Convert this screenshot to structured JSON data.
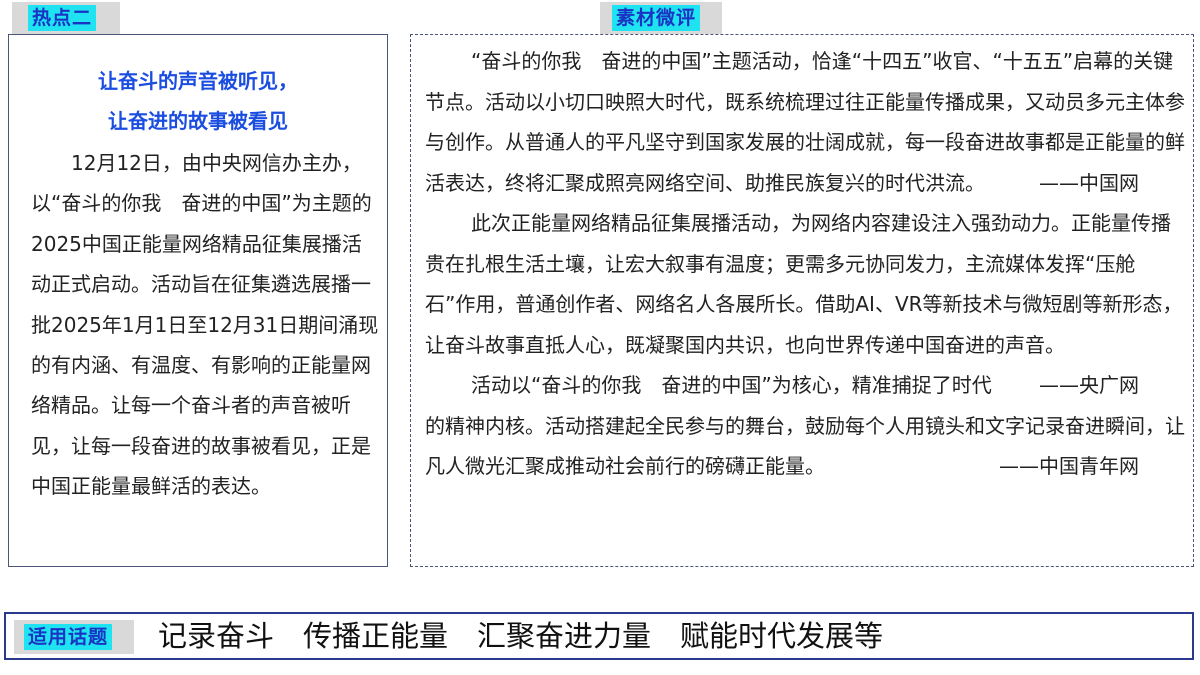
{
  "left": {
    "tag": "热点二",
    "title_line1": "让奋斗的声音被听见，",
    "title_line2": "让奋进的故事被看见",
    "body": "12月12日，由中央网信办主办，以“奋斗的你我　奋进的中国”为主题的2025中国正能量网络精品征集展播活动正式启动。活动旨在征集遴选展播一批2025年1月1日至12月31日期间涌现的有内涵、有温度、有影响的正能量网络精品。让每一个奋斗者的声音被听见，让每一段奋进的故事被看见，正是中国正能量最鲜活的表达。"
  },
  "right": {
    "tag": "素材微评",
    "comments": [
      {
        "text": "“奋斗的你我　奋进的中国”主题活动，恰逢“十四五”收官、“十五五”启幕的关键节点。活动以小切口映照大时代，既系统梳理过往正能量传播成果，又动员多元主体参与创作。从普通人的平凡坚守到国家发展的壮阔成就，每一段奋进故事都是正能量的鲜活表达，终将汇聚成照亮网络空间、助推民族复兴的时代洪流。",
        "source": "——中国网"
      },
      {
        "text": "此次正能量网络精品征集展播活动，为网络内容建设注入强劲动力。正能量传播贵在扎根生活土壤，让宏大叙事有温度；更需多元协同发力，主流媒体发挥“压舱石”作用，普通创作者、网络名人各展所长。借助AI、VR等新技术与微短剧等新形态，让奋斗故事直抵人心，既凝聚国内共识，也向世界传递中国奋进的声音。",
        "source": "——央广网"
      },
      {
        "text": "活动以“奋斗的你我　奋进的中国”为核心，精准捕捉了时代的精神内核。活动搭建起全民参与的舞台，鼓励每个人用镜头和文字记录奋进瞬间，让凡人微光汇聚成推动社会前行的磅礴正能量。",
        "source": "——中国青年网"
      }
    ]
  },
  "bottom": {
    "tag": "适用话题",
    "topics": "记录奋斗　传播正能量　汇聚奋进力量　赋能时代发展等"
  },
  "colors": {
    "tag_highlight": "#1fe3f0",
    "tag_text": "#1a33c4",
    "title_blue": "#1a4de0",
    "border": "#4a5578"
  }
}
